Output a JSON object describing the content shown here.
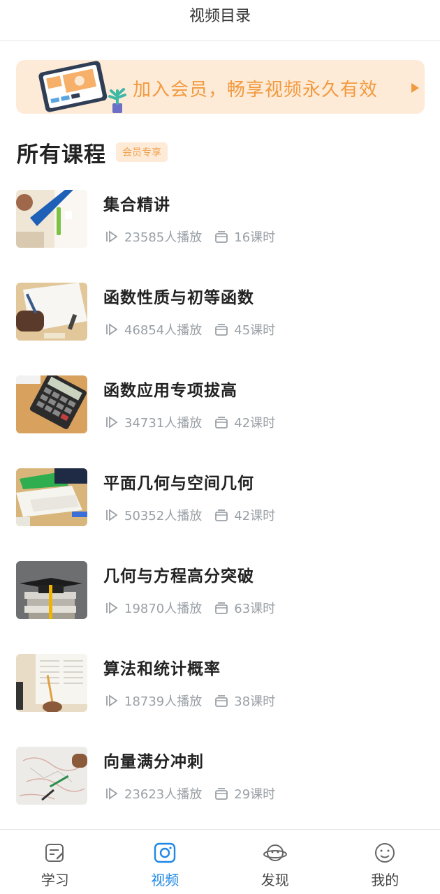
{
  "header": {
    "title": "视频目录"
  },
  "banner": {
    "text": "加入会员，畅享视频永久有效",
    "accent": "#f29a3f"
  },
  "section": {
    "title": "所有课程",
    "badge": "会员专享"
  },
  "courses": [
    {
      "title": "集合精讲",
      "plays": "23585人播放",
      "lessons": "16课时",
      "thumb": "ruler-pen-desk"
    },
    {
      "title": "函数性质与初等函数",
      "plays": "46854人播放",
      "lessons": "45课时",
      "thumb": "hand-writing-notes"
    },
    {
      "title": "函数应用专项拔高",
      "plays": "34731人播放",
      "lessons": "42课时",
      "thumb": "calculator-desk"
    },
    {
      "title": "平面几何与空间几何",
      "plays": "50352人播放",
      "lessons": "42课时",
      "thumb": "books-on-desk"
    },
    {
      "title": "几何与方程高分突破",
      "plays": "19870人播放",
      "lessons": "63课时",
      "thumb": "graduation-cap-books"
    },
    {
      "title": "算法和统计概率",
      "plays": "18739人播放",
      "lessons": "38课时",
      "thumb": "open-book-pencil"
    },
    {
      "title": "向量满分冲刺",
      "plays": "23623人播放",
      "lessons": "29课时",
      "thumb": "drawing-paper"
    }
  ],
  "tabs": [
    {
      "label": "学习",
      "icon": "notepad-icon",
      "active": false
    },
    {
      "label": "视频",
      "icon": "camera-icon",
      "active": true
    },
    {
      "label": "发现",
      "icon": "planet-icon",
      "active": false
    },
    {
      "label": "我的",
      "icon": "smiley-icon",
      "active": false
    }
  ],
  "colors": {
    "active_tab": "#1e88e5",
    "meta_gray": "#9aa0a6",
    "badge_bg": "#fdebd8"
  }
}
